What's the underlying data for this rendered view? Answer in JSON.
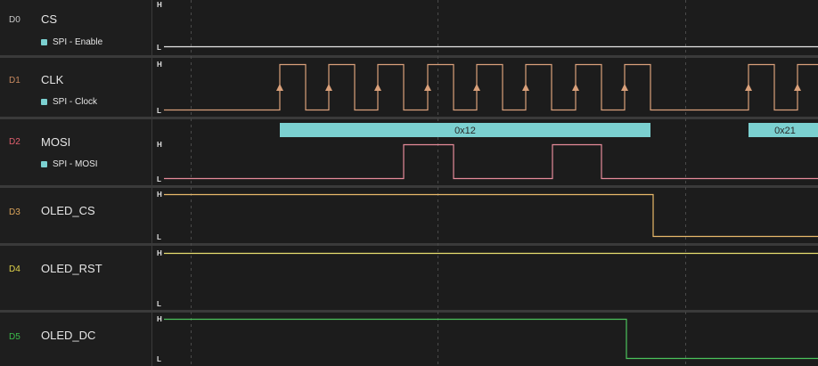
{
  "channels": [
    {
      "index": "D0",
      "name": "CS",
      "analyzer": "SPI - Enable",
      "color": "#e6e6e6",
      "index_color": "#c8c8c8"
    },
    {
      "index": "D1",
      "name": "CLK",
      "analyzer": "SPI - Clock",
      "color": "#d9a07a",
      "index_color": "#c98a60"
    },
    {
      "index": "D2",
      "name": "MOSI",
      "analyzer": "SPI - MOSI",
      "color": "#e58a99",
      "index_color": "#e0606e"
    },
    {
      "index": "D3",
      "name": "OLED_CS",
      "analyzer": "",
      "color": "#e8b86a",
      "index_color": "#d9a35a"
    },
    {
      "index": "D4",
      "name": "OLED_RST",
      "analyzer": "",
      "color": "#e9e070",
      "index_color": "#e0d34a"
    },
    {
      "index": "D5",
      "name": "OLED_DC",
      "analyzer": "",
      "color": "#4bc35b",
      "index_color": "#3bbd4a"
    }
  ],
  "level_labels": {
    "high": "H",
    "low": "L"
  },
  "decoded": [
    {
      "text": "0x12",
      "color": "#7bd0d0"
    },
    {
      "text": "0x21",
      "color": "#7bd0d0"
    }
  ]
}
